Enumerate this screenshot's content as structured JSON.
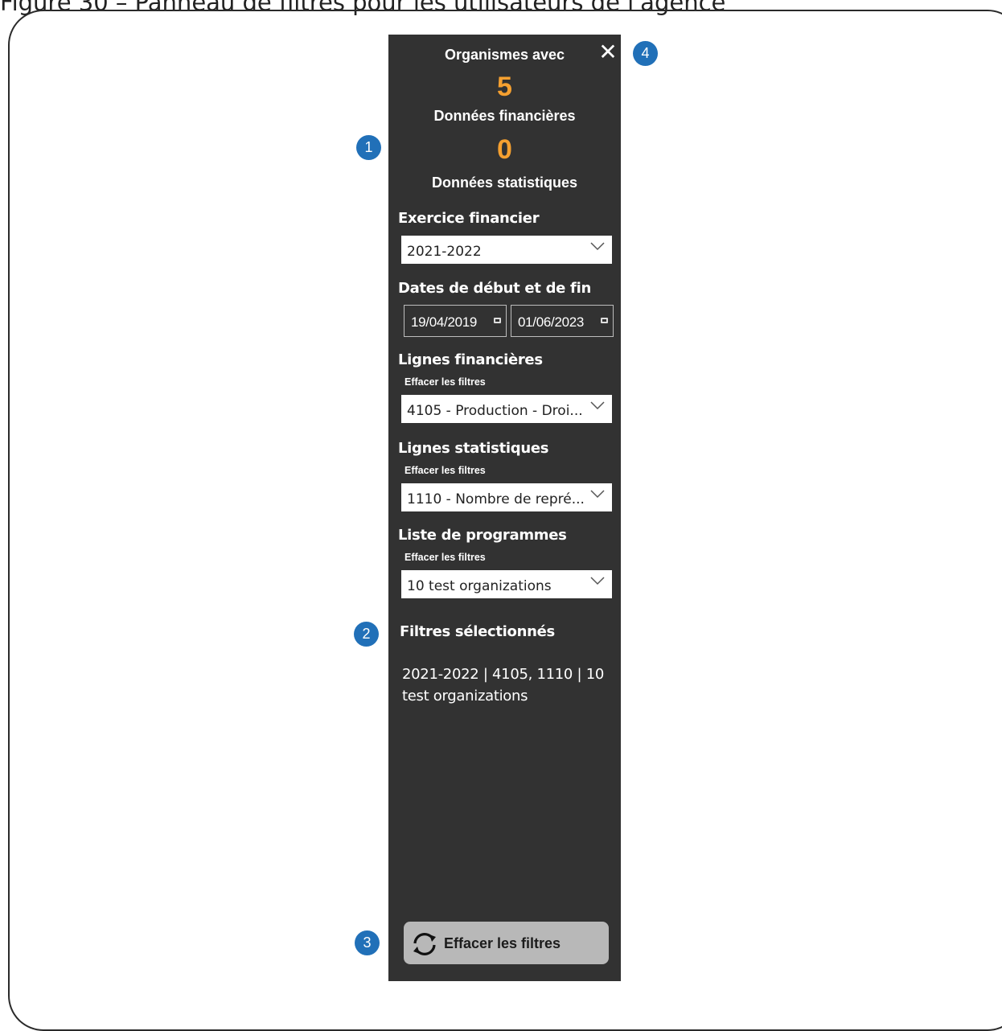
{
  "caption": "Figure 30 – Panneau de filtres pour les utilisateurs de l'agence",
  "panel": {
    "title": "Organismes avec",
    "financial_count": "5",
    "financial_label": "Données financières",
    "statistical_count": "0",
    "statistical_label": "Données statistiques"
  },
  "fiscal_year": {
    "label": "Exercice financier",
    "value": "2021-2022"
  },
  "dates": {
    "label": "Dates de début et de fin",
    "start": "19/04/2019",
    "end": "01/06/2023"
  },
  "financial_lines": {
    "label": "Lignes financières",
    "clear": "Effacer les filtres",
    "value": "4105 - Production - Droi..."
  },
  "statistical_lines": {
    "label": "Lignes statistiques",
    "clear": "Effacer les filtres",
    "value": "1110 - Nombre de repré..."
  },
  "programs": {
    "label": "Liste de programmes",
    "clear": "Effacer les filtres",
    "value": "10 test organizations"
  },
  "selected_filters": {
    "label": "Filtres sélectionnés",
    "summary": "2021-2022 | 4105, 1110 | 10 test organizations"
  },
  "reset_button": {
    "label": "Effacer les filtres"
  },
  "badges": {
    "b1": "1",
    "b2": "2",
    "b3": "3",
    "b4": "4"
  },
  "colors": {
    "panel_bg": "#323232",
    "accent_number": "#f5a030",
    "badge": "#2170b8",
    "button_bg": "#b8b8b8"
  },
  "icons": {
    "close": "close-icon",
    "chevron": "chevron-down-icon",
    "calendar": "calendar-icon",
    "refresh": "refresh-icon"
  }
}
